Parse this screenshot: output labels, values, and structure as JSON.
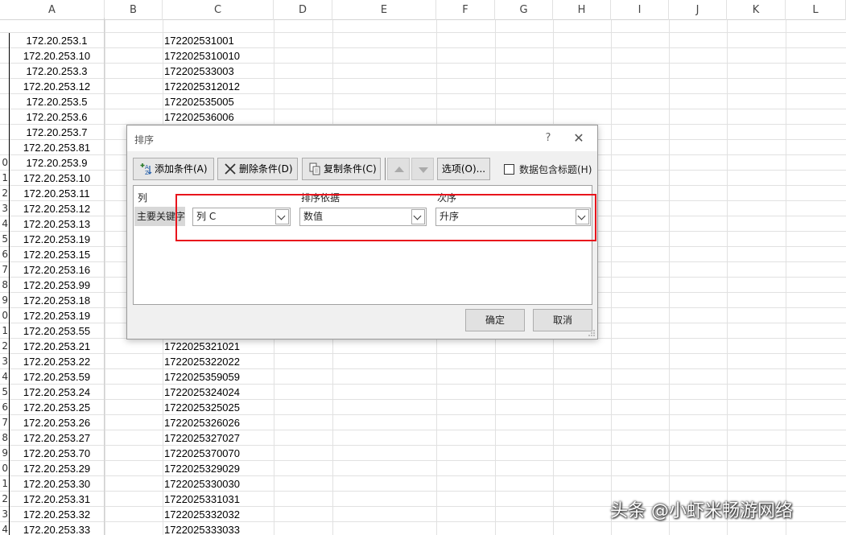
{
  "sheet": {
    "columns": [
      "A",
      "B",
      "C",
      "D",
      "E",
      "F",
      "G",
      "H",
      "I",
      "J",
      "K",
      "L"
    ],
    "rows": [
      {
        "num": "",
        "a": "",
        "c": ""
      },
      {
        "num": "",
        "a": "172.20.253.1",
        "c": "172202531001"
      },
      {
        "num": "",
        "a": "172.20.253.10",
        "c": "1722025310010"
      },
      {
        "num": "",
        "a": "172.20.253.3",
        "c": "172202533003"
      },
      {
        "num": "",
        "a": "172.20.253.12",
        "c": "1722025312012"
      },
      {
        "num": "",
        "a": "172.20.253.5",
        "c": "172202535005"
      },
      {
        "num": "",
        "a": "172.20.253.6",
        "c": "172202536006"
      },
      {
        "num": "",
        "a": "172.20.253.7",
        "c": ""
      },
      {
        "num": "",
        "a": "172.20.253.81",
        "c": ""
      },
      {
        "num": "0",
        "a": "172.20.253.9",
        "c": ""
      },
      {
        "num": "1",
        "a": "172.20.253.10",
        "c": ""
      },
      {
        "num": "2",
        "a": "172.20.253.11",
        "c": ""
      },
      {
        "num": "3",
        "a": "172.20.253.12",
        "c": ""
      },
      {
        "num": "4",
        "a": "172.20.253.13",
        "c": ""
      },
      {
        "num": "5",
        "a": "172.20.253.19",
        "c": ""
      },
      {
        "num": "6",
        "a": "172.20.253.15",
        "c": ""
      },
      {
        "num": "7",
        "a": "172.20.253.16",
        "c": ""
      },
      {
        "num": "8",
        "a": "172.20.253.99",
        "c": ""
      },
      {
        "num": "9",
        "a": "172.20.253.18",
        "c": ""
      },
      {
        "num": "0",
        "a": "172.20.253.19",
        "c": ""
      },
      {
        "num": "1",
        "a": "172.20.253.55",
        "c": ""
      },
      {
        "num": "2",
        "a": "172.20.253.21",
        "c": "1722025321021"
      },
      {
        "num": "3",
        "a": "172.20.253.22",
        "c": "1722025322022"
      },
      {
        "num": "4",
        "a": "172.20.253.59",
        "c": "1722025359059"
      },
      {
        "num": "5",
        "a": "172.20.253.24",
        "c": "1722025324024"
      },
      {
        "num": "6",
        "a": "172.20.253.25",
        "c": "1722025325025"
      },
      {
        "num": "7",
        "a": "172.20.253.26",
        "c": "1722025326026"
      },
      {
        "num": "8",
        "a": "172.20.253.27",
        "c": "1722025327027"
      },
      {
        "num": "9",
        "a": "172.20.253.70",
        "c": "1722025370070"
      },
      {
        "num": "0",
        "a": "172.20.253.29",
        "c": "1722025329029"
      },
      {
        "num": "1",
        "a": "172.20.253.30",
        "c": "1722025330030"
      },
      {
        "num": "2",
        "a": "172.20.253.31",
        "c": "1722025331031"
      },
      {
        "num": "3",
        "a": "172.20.253.32",
        "c": "1722025332032"
      },
      {
        "num": "4",
        "a": "172.20.253.33",
        "c": "1722025333033"
      }
    ]
  },
  "dialog": {
    "title": "排序",
    "help": "?",
    "close": "✕",
    "toolbar": {
      "add_label": "添加条件(A)",
      "delete_label": "删除条件(D)",
      "copy_label": "复制条件(C)",
      "options_label": "选项(O)...",
      "header_checkbox_label": "数据包含标题(H)"
    },
    "headers": {
      "column": "列",
      "sort_on": "排序依据",
      "order": "次序"
    },
    "rule": {
      "label": "主要关键字",
      "column_value": "列 C",
      "sort_on_value": "数值",
      "order_value": "升序"
    },
    "ok_label": "确定",
    "cancel_label": "取消"
  },
  "highlight_color": "#e8141c",
  "watermark": "头条 @小虾米畅游网络"
}
